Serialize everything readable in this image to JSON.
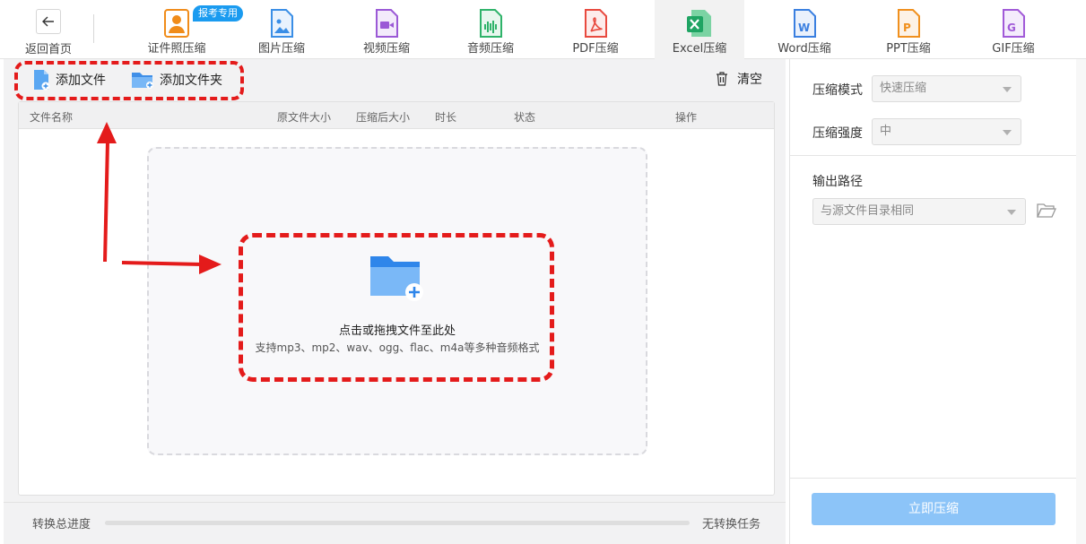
{
  "nav": {
    "back_label": "返回首页",
    "tools": [
      {
        "label": "证件照压缩",
        "icon": "id-photo-icon",
        "color": "#f08c1a",
        "badge": "报考专用"
      },
      {
        "label": "图片压缩",
        "icon": "image-icon",
        "color": "#3a8ee6"
      },
      {
        "label": "视频压缩",
        "icon": "video-icon",
        "color": "#9b59d6"
      },
      {
        "label": "音频压缩",
        "icon": "audio-icon",
        "color": "#2fb36a"
      },
      {
        "label": "PDF压缩",
        "icon": "pdf-icon",
        "color": "#e84a3f"
      },
      {
        "label": "Excel压缩",
        "icon": "excel-icon",
        "color": "#1fa463",
        "active": true
      },
      {
        "label": "Word压缩",
        "icon": "word-icon",
        "color": "#3a7fe0"
      },
      {
        "label": "PPT压缩",
        "icon": "ppt-icon",
        "color": "#f0901e"
      },
      {
        "label": "GIF压缩",
        "icon": "gif-icon",
        "color": "#a15ad8"
      }
    ]
  },
  "actions": {
    "add_file": "添加文件",
    "add_folder": "添加文件夹",
    "clear": "清空"
  },
  "table": {
    "columns": [
      "文件名称",
      "原文件大小",
      "压缩后大小",
      "时长",
      "状态",
      "操作"
    ]
  },
  "dropzone": {
    "title": "点击或拖拽文件至此处",
    "subtitle": "支持mp3、mp2、wav、ogg、flac、m4a等多种音频格式"
  },
  "progress": {
    "label": "转换总进度",
    "status": "无转换任务",
    "value": 0
  },
  "settings": {
    "mode_label": "压缩模式",
    "mode_value": "快速压缩",
    "strength_label": "压缩强度",
    "strength_value": "中",
    "output_label": "输出路径",
    "output_value": "与源文件目录相同",
    "submit_label": "立即压缩"
  },
  "colors": {
    "accent": "#1a9bf0",
    "callout": "#e41b1b",
    "submit_disabled": "#8cc4f8"
  }
}
